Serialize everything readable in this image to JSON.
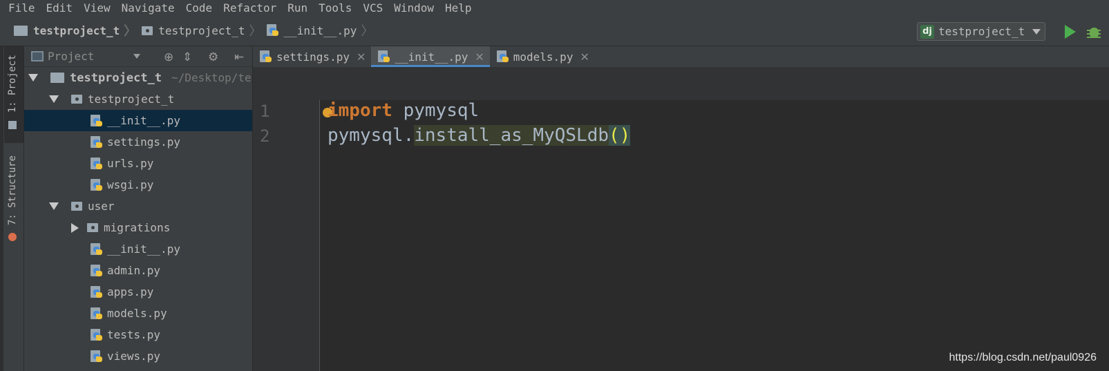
{
  "menu": [
    "File",
    "Edit",
    "View",
    "Navigate",
    "Code",
    "Refactor",
    "Run",
    "Tools",
    "VCS",
    "Window",
    "Help"
  ],
  "breadcrumbs": [
    "testproject_t",
    "testproject_t",
    "__init__.py"
  ],
  "run_config": {
    "icon_text": "dj",
    "label": "testproject_t"
  },
  "tool_windows": {
    "project": "1: Project",
    "structure": "7: Structure"
  },
  "project_panel": {
    "title": "Project",
    "tree": [
      {
        "name": "testproject_t",
        "path": "~/Desktop/te",
        "type": "root"
      },
      {
        "name": "testproject_t",
        "type": "package"
      },
      {
        "name": "__init__.py",
        "type": "py",
        "selected": true
      },
      {
        "name": "settings.py",
        "type": "py"
      },
      {
        "name": "urls.py",
        "type": "py"
      },
      {
        "name": "wsgi.py",
        "type": "py"
      },
      {
        "name": "user",
        "type": "package"
      },
      {
        "name": "migrations",
        "type": "package"
      },
      {
        "name": "__init__.py",
        "type": "py"
      },
      {
        "name": "admin.py",
        "type": "py"
      },
      {
        "name": "apps.py",
        "type": "py"
      },
      {
        "name": "models.py",
        "type": "py"
      },
      {
        "name": "tests.py",
        "type": "py"
      },
      {
        "name": "views.py",
        "type": "py"
      }
    ]
  },
  "tabs": [
    {
      "label": "settings.py",
      "active": false
    },
    {
      "label": "__init__.py",
      "active": true
    },
    {
      "label": "models.py",
      "active": false
    }
  ],
  "editor": {
    "line_numbers": [
      "1",
      "2"
    ],
    "line1": {
      "keyword": "import",
      "rest": " pymysql"
    },
    "line2": {
      "module": "pymysql.",
      "call": "install_as_MyQSLdb",
      "parens": "()"
    }
  },
  "watermark": "https://blog.csdn.net/paul0926",
  "colors": {
    "keyword": "#cc7832",
    "selection": "#0d293e",
    "tab_underline": "#4a88c7",
    "run": "#4cae4f"
  }
}
